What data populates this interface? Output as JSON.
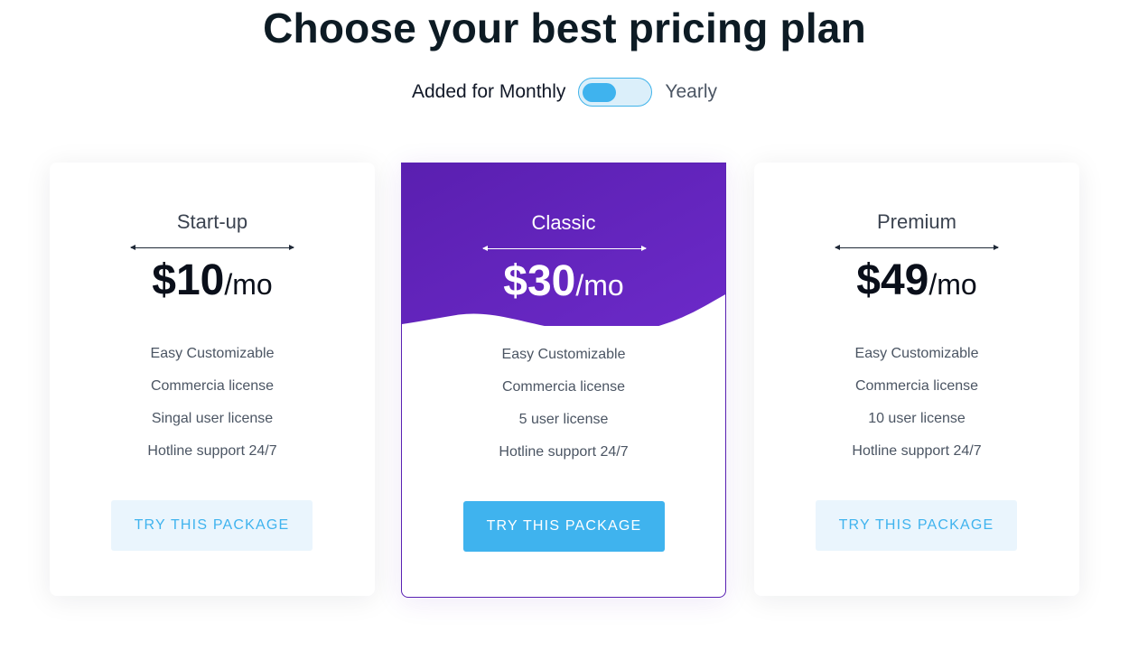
{
  "header": {
    "title": "Choose your best pricing plan"
  },
  "billing": {
    "monthly_label": "Added for Monthly",
    "yearly_label": "Yearly"
  },
  "colors": {
    "accent": "#3fb3ee",
    "featured_gradient_start": "#5a1fb0",
    "featured_gradient_end": "#6c2ac9"
  },
  "plans": [
    {
      "name": "Start-up",
      "price": "$10",
      "unit": "/mo",
      "features": [
        "Easy Customizable",
        "Commercia license",
        "Singal user license",
        "Hotline support 24/7"
      ],
      "cta": "TRY THIS PACKAGE"
    },
    {
      "name": "Classic",
      "price": "$30",
      "unit": "/mo",
      "features": [
        "Easy Customizable",
        "Commercia license",
        "5 user license",
        "Hotline support 24/7"
      ],
      "cta": "TRY THIS PACKAGE"
    },
    {
      "name": "Premium",
      "price": "$49",
      "unit": "/mo",
      "features": [
        "Easy Customizable",
        "Commercia license",
        "10 user license",
        "Hotline support 24/7"
      ],
      "cta": "TRY THIS PACKAGE"
    }
  ]
}
